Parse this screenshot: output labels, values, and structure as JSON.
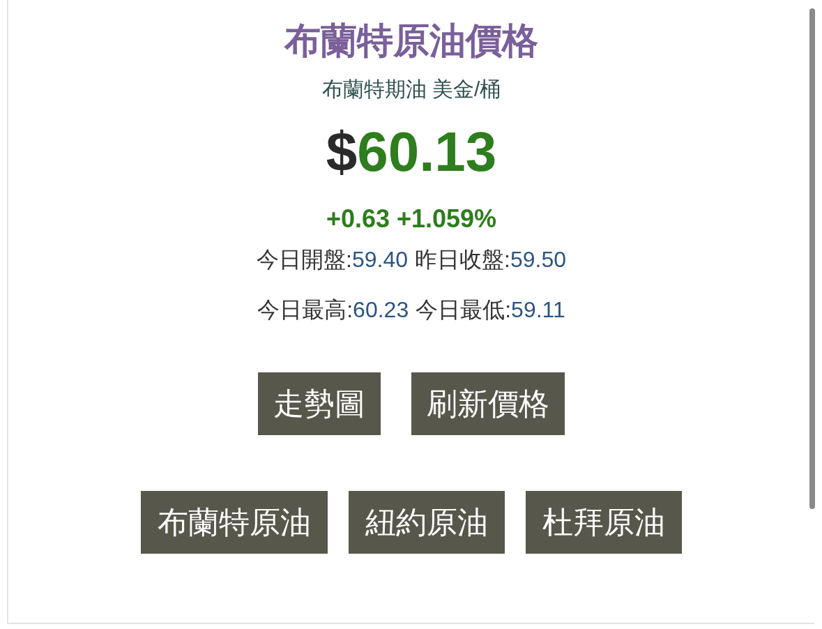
{
  "title": "布蘭特原油價格",
  "subtitle": "布蘭特期油 美金/桶",
  "price": {
    "currency": "$",
    "value": "60.13"
  },
  "change": "+0.63 +1.059%",
  "stats": [
    [
      {
        "label": "今日開盤:",
        "value": "59.40"
      },
      {
        "label": "昨日收盤:",
        "value": "59.50"
      }
    ],
    [
      {
        "label": "今日最高:",
        "value": "60.23"
      },
      {
        "label": "今日最低:",
        "value": "59.11"
      }
    ]
  ],
  "actions": [
    "走勢圖",
    "刷新價格"
  ],
  "markets": [
    "布蘭特原油",
    "紐約原油",
    "杜拜原油"
  ]
}
